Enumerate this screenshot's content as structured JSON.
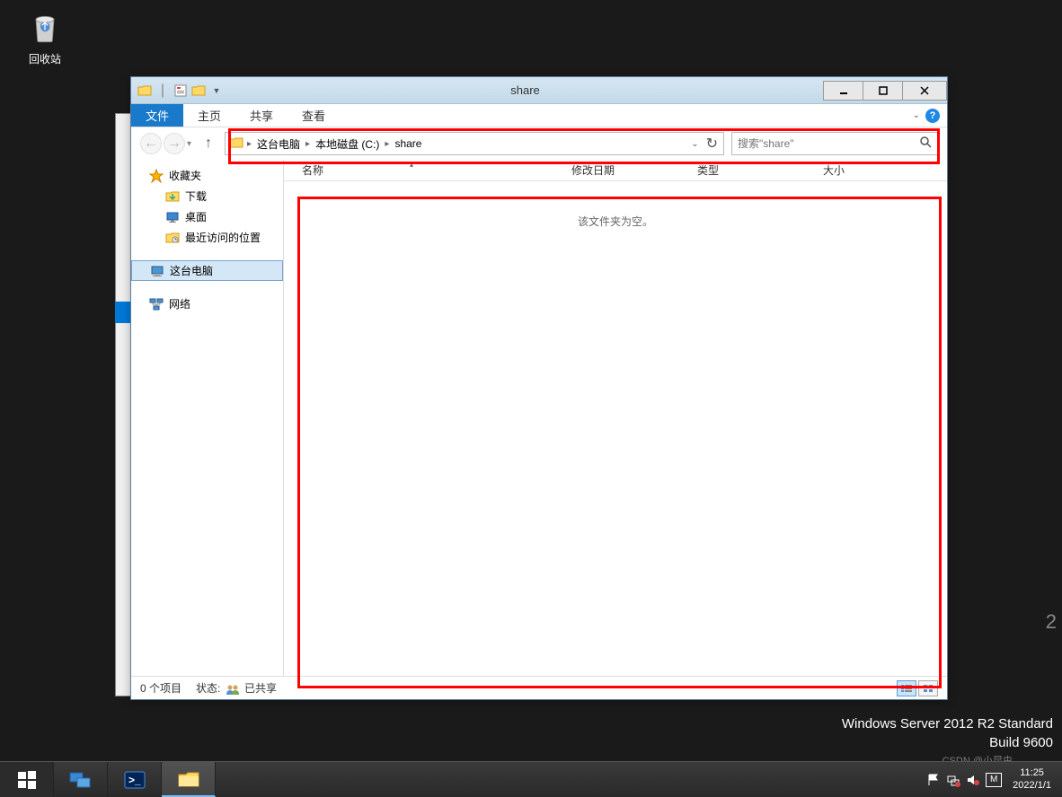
{
  "desktop": {
    "recycle_bin": "回收站"
  },
  "watermark": {
    "line1": "Windows Server 2012 R2 Standard",
    "line2": "Build 9600",
    "partial": "2",
    "csdn": "CSDN @小昆虫"
  },
  "window": {
    "title": "share",
    "tabs": {
      "file": "文件",
      "home": "主页",
      "share": "共享",
      "view": "查看"
    },
    "breadcrumb": {
      "computer": "这台电脑",
      "drive": "本地磁盘 (C:)",
      "folder": "share"
    },
    "search_placeholder": "搜索\"share\"",
    "columns": {
      "name": "名称",
      "date": "修改日期",
      "type": "类型",
      "size": "大小"
    },
    "empty_message": "该文件夹为空。",
    "nav_tree": {
      "favorites": "收藏夹",
      "downloads": "下载",
      "desktop": "桌面",
      "recent": "最近访问的位置",
      "computer": "这台电脑",
      "network": "网络"
    },
    "status": {
      "items": "0 个项目",
      "state_label": "状态:",
      "state_value": "已共享"
    }
  },
  "taskbar": {
    "time": "11:25",
    "date": "2022/1/1"
  }
}
